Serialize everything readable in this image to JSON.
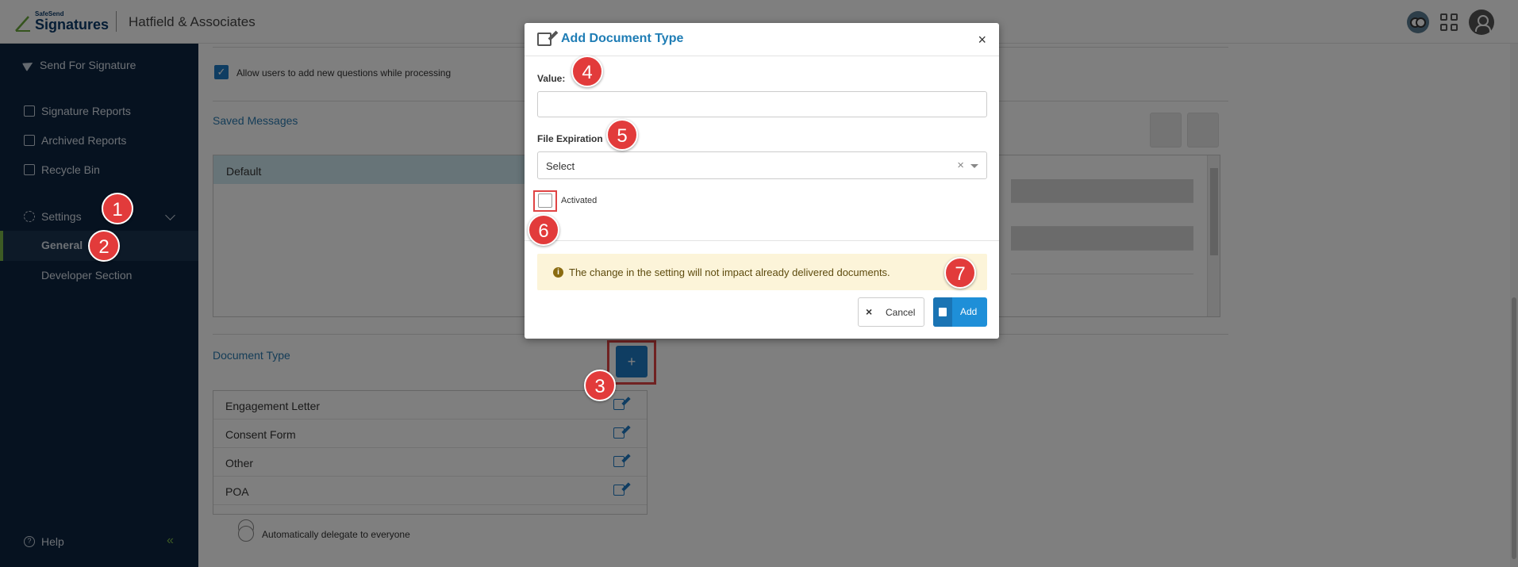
{
  "header": {
    "logo_small": "SafeSend",
    "logo_big": "Signatures",
    "company": "Hatfield & Associates"
  },
  "sidebar": {
    "items": [
      {
        "label": "Send For Signature",
        "icon": "send-icon"
      },
      {
        "label": "Signature Reports",
        "icon": "report-icon"
      },
      {
        "label": "Archived Reports",
        "icon": "archive-icon"
      },
      {
        "label": "Recycle Bin",
        "icon": "trash-icon"
      },
      {
        "label": "Settings",
        "icon": "gear-icon"
      },
      {
        "label": "General"
      },
      {
        "label": "Developer Section"
      }
    ],
    "help_label": "Help",
    "collapse_glyph": "«"
  },
  "main": {
    "allow_questions_label": "Allow users to add new questions while processing",
    "saved_messages_title": "Saved Messages",
    "default_message": "Default",
    "document_type_title": "Document Type",
    "add_glyph": "+",
    "document_types": [
      "Engagement Letter",
      "Consent Form",
      "Other",
      "POA"
    ],
    "delegate_label": "Automatically delegate to everyone"
  },
  "modal": {
    "title": "Add Document Type",
    "close_glyph": "×",
    "value_label": "Value:",
    "value_input": "",
    "file_expiration_label": "File Expiration",
    "file_expiration_selected": "Select",
    "clear_glyph": "×",
    "activated_label": "Activated",
    "activated_checked": false,
    "warning_text": "The change in the setting will not impact already delivered documents.",
    "cancel_label": "Cancel",
    "cancel_glyph": "×",
    "add_label": "Add"
  },
  "badges": [
    "1",
    "2",
    "3",
    "4",
    "5",
    "6",
    "7"
  ],
  "colors": {
    "sidebar_bg": "#0c2440",
    "accent_blue": "#1e7ac4",
    "badge_red": "#e23b3b",
    "warning_bg": "#fcf4d9",
    "active_green": "#7ab648"
  }
}
